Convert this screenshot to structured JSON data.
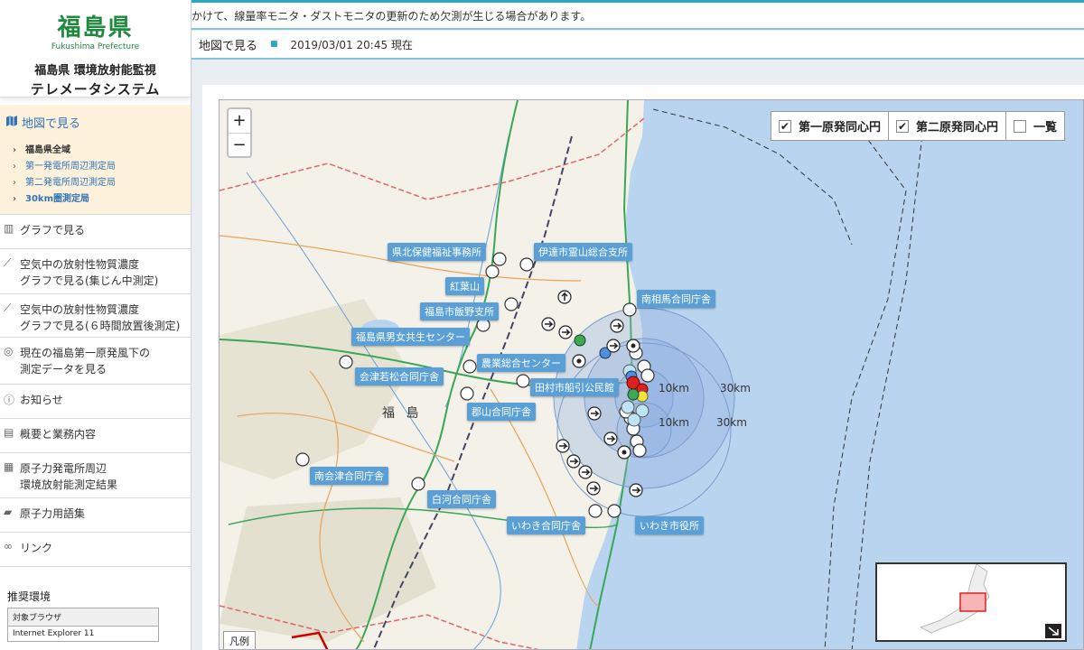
{
  "sidebar": {
    "prefecture": "福島県",
    "prefecture_en": "Fukushima Prefecture",
    "system_line1": "福島県 環境放射能監視",
    "system_line2": "テレメータシステム",
    "active_menu": "地図で見る",
    "submenu": [
      {
        "label": "福島県全域"
      },
      {
        "label": "第一発電所周辺測定局"
      },
      {
        "label": "第二発電所周辺測定局"
      },
      {
        "label": "30km圏測定局"
      }
    ],
    "menu_graph": "グラフで見る",
    "menu_air1_a": "空気中の放射性物質濃度",
    "menu_air1_b": "グラフで見る(集じん中測定)",
    "menu_air2_a": "空気中の放射性物質濃度",
    "menu_air2_b": "グラフで見る(６時間放置後測定)",
    "menu_wind_a": "現在の福島第一原発風下の",
    "menu_wind_b": "測定データを見る",
    "menu_news": "お知らせ",
    "menu_about": "概要と業務内容",
    "menu_npp_a": "原子力発電所周辺",
    "menu_npp_b": "環境放射能測定結果",
    "menu_glossary": "原子力用語集",
    "menu_links": "リンク",
    "env_title": "推奨環境",
    "env_header": "対象ブラウザ",
    "env_value": "Internet Explorer 11"
  },
  "notice": "かけて、線量率モニタ・ダストモニタの更新のため欠測が生じる場合があります。",
  "breadcrumb": {
    "title": "地図で見る",
    "time": "2019/03/01 20:45 現在"
  },
  "map": {
    "zoom_in": "+",
    "zoom_out": "−",
    "toggle1": "第一原発同心円",
    "toggle2": "第二原発同心円",
    "toggle3": "一覧",
    "legend": "凡例",
    "ring10": "10km",
    "ring30": "30km",
    "city_fukushima": "福 島",
    "labels": [
      "県北保健福祉事務所",
      "伊達市霊山総合支所",
      "紅葉山",
      "南相馬合同庁舎",
      "福島市飯野支所",
      "福島県男女共生センター",
      "農業総合センター",
      "会津若松合同庁舎",
      "田村市船引公民館",
      "郡山合同庁舎",
      "南会津合同庁舎",
      "白河合同庁舎",
      "いわき合同庁舎",
      "いわき市役所"
    ],
    "colors": {
      "land": "#f3f1e8",
      "sea": "#b9d4ee",
      "ring": "#7fa7d9",
      "label": "#5a9fd6"
    }
  }
}
